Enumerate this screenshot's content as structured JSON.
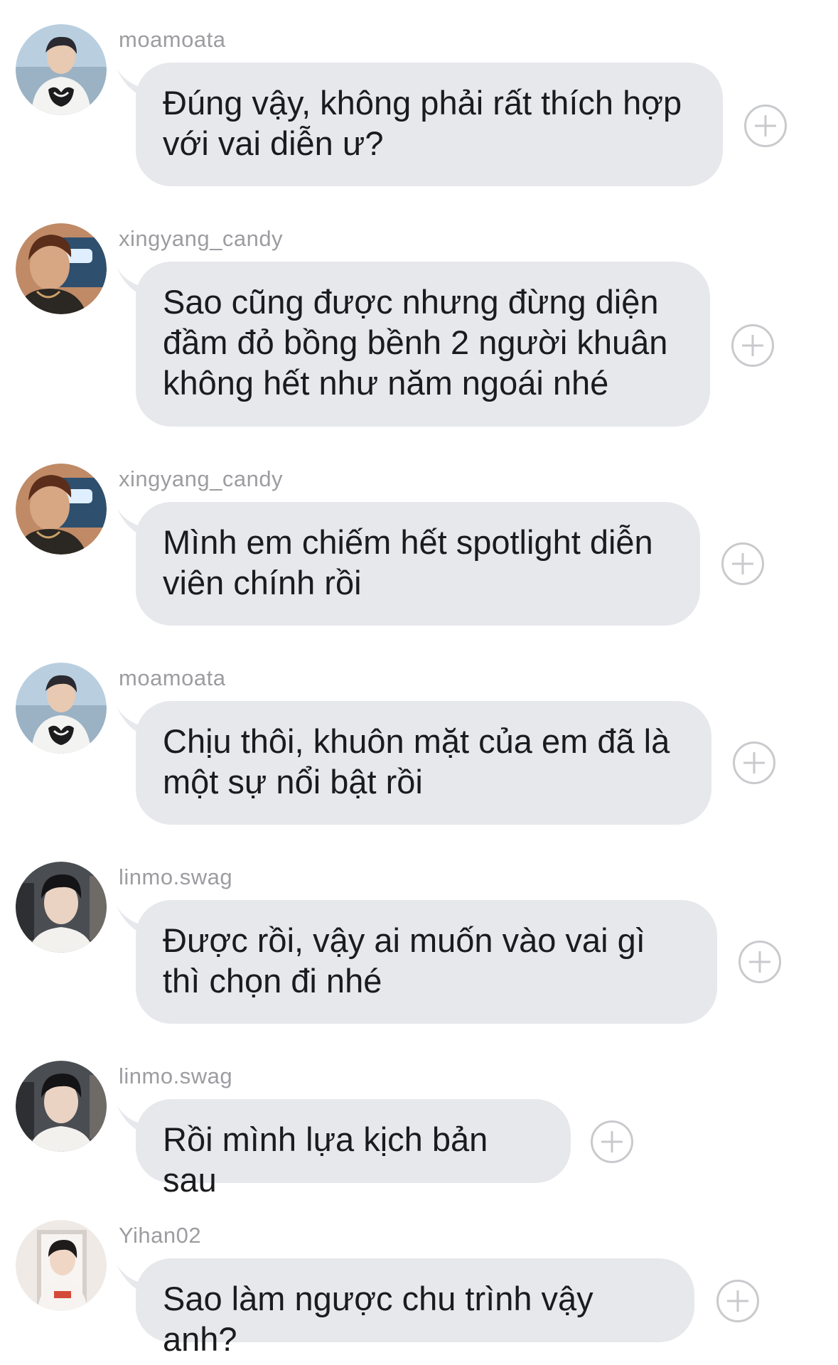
{
  "messages": [
    {
      "username": "moamoata",
      "text": "Đúng vậy, không phải rất thích hợp với vai diễn ư?",
      "avatar_icon": "avatar-moamoata"
    },
    {
      "username": "xingyang_candy",
      "text": "Sao cũng được nhưng đừng diện đầm đỏ bồng bềnh 2 người khuân không hết như năm ngoái nhé",
      "avatar_icon": "avatar-xingyang"
    },
    {
      "username": "xingyang_candy",
      "text": "Mình em chiếm hết spotlight diễn viên chính rồi",
      "avatar_icon": "avatar-xingyang"
    },
    {
      "username": "moamoata",
      "text": "Chịu thôi, khuôn mặt của em đã là một sự nổi bật rồi",
      "avatar_icon": "avatar-moamoata"
    },
    {
      "username": "linmo.swag",
      "text": "Được rồi, vậy ai muốn vào vai gì thì chọn đi nhé",
      "avatar_icon": "avatar-linmo"
    },
    {
      "username": "linmo.swag",
      "text": "Rồi mình lựa kịch bản sau",
      "avatar_icon": "avatar-linmo"
    },
    {
      "username": "Yihan02",
      "text": "Sao làm ngược chu trình vậy anh?",
      "avatar_icon": "avatar-yihan"
    }
  ],
  "colors": {
    "bubble": "#e7e8ec",
    "username": "#9c9ca1",
    "text": "#1b1b1d",
    "plus": "#c9cacd"
  }
}
